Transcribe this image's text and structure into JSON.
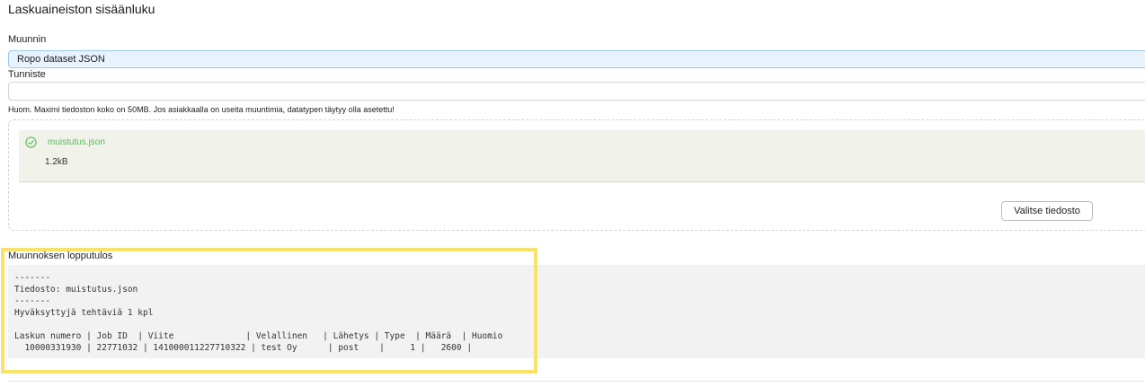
{
  "page": {
    "title": "Laskuaineiston sisäänluku"
  },
  "form": {
    "converter_label": "Muunnin",
    "converter_value": "Ropo dataset JSON",
    "identifier_label": "Tunniste",
    "identifier_value": "",
    "hint": "Huom. Maximi tiedoston koko on 50MB. Jos asiakkaalla on useita muuntimia, datatypen täytyy olla asetettu!"
  },
  "upload": {
    "file_name": "muistutus.json",
    "file_size": "1.2kB",
    "status_icon": "check-circle-icon",
    "select_button": "Valitse tiedosto"
  },
  "result": {
    "label": "Muunnoksen lopputulos",
    "lines": [
      "-------",
      "Tiedosto: muistutus.json",
      "-------",
      "Hyväksyttyjä tehtäviä 1 kpl",
      "",
      "Laskun numero | Job ID  | Viite              | Velallinen   | Lähetys | Type  | Määrä  | Huomio",
      "  10000331930 | 22771032 | 141000011227710322 | test Oy      | post    |     1 |   2600 |"
    ]
  },
  "colors": {
    "select_bg": "#e8f3fd",
    "success": "#5cb85c",
    "highlight": "#f7e26b",
    "result_bg": "#f2f2f2"
  }
}
